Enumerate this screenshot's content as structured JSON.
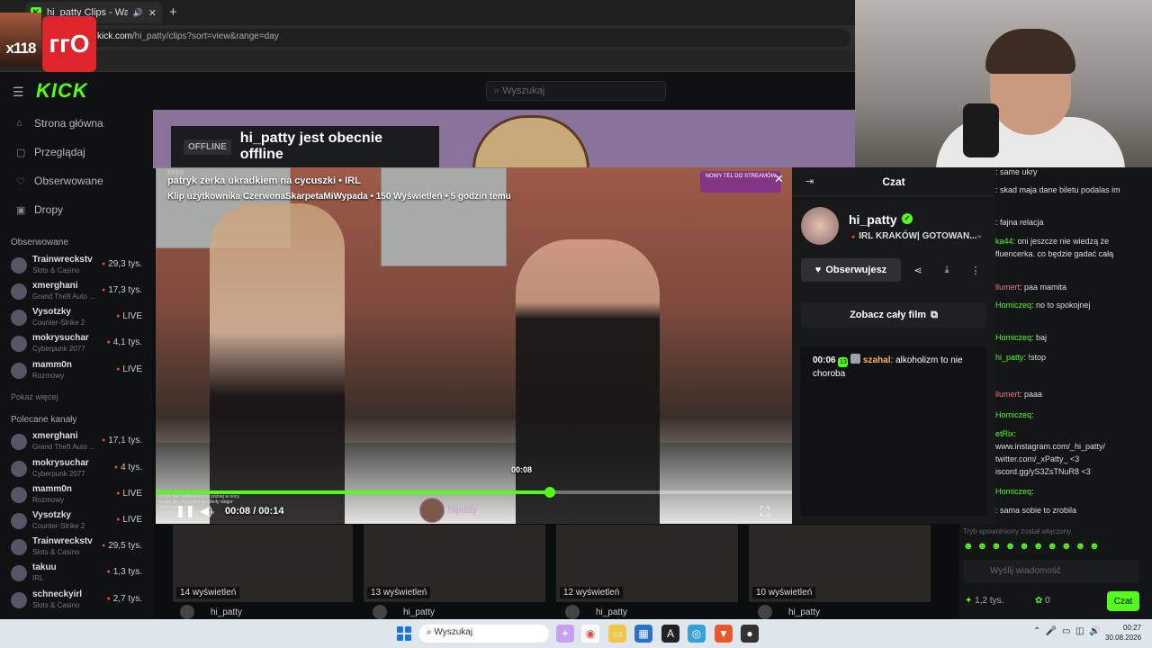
{
  "browser": {
    "tab_title": "hi_patty Clips - Watch Live",
    "url_host": "kick.com",
    "url_path": "/hi_patty/clips?sort=view&range=day"
  },
  "overlay": {
    "logo_left": "x118",
    "logo_right": "ᴦᴦO"
  },
  "kick": {
    "logo": "KICK",
    "search_placeholder": "Wyszukaj",
    "nav": [
      "Strona główna",
      "Przeglądaj",
      "Obserwowane",
      "Dropy"
    ],
    "followed_title": "Obserwowane",
    "followed": [
      {
        "name": "Trainwreckstv",
        "cat": "Slots & Casino",
        "viewers": "29,3 tys."
      },
      {
        "name": "xmerghani",
        "cat": "Grand Theft Auto ...",
        "viewers": "17,3 tys."
      },
      {
        "name": "Vysotzky",
        "cat": "Counter-Strike 2",
        "viewers": "LIVE"
      },
      {
        "name": "mokrysuchar",
        "cat": "Cyberpunk 2077",
        "viewers": "4,1 tys."
      },
      {
        "name": "mamm0n",
        "cat": "Rozmowy",
        "viewers": "LIVE"
      }
    ],
    "show_more": "Pokaż więcej",
    "recommended_title": "Polecane kanały",
    "recommended": [
      {
        "name": "xmerghani",
        "cat": "Grand Theft Auto ...",
        "viewers": "17,1 tys."
      },
      {
        "name": "mokrysuchar",
        "cat": "Cyberpunk 2077",
        "viewers": "4 tys."
      },
      {
        "name": "mamm0n",
        "cat": "Rozmowy",
        "viewers": "LIVE"
      },
      {
        "name": "Vysotzky",
        "cat": "Counter-Strike 2",
        "viewers": "LIVE"
      },
      {
        "name": "Trainwreckstv",
        "cat": "Slots & Casino",
        "viewers": "29,5 tys."
      },
      {
        "name": "takuu",
        "cat": "IRL",
        "viewers": "1,3 tys."
      },
      {
        "name": "schneckyirl",
        "cat": "Slots & Casino",
        "viewers": "2,7 tys."
      }
    ],
    "offline_tag": "OFFLINE",
    "offline_text": "hi_patty jest obecnie offline",
    "clips": [
      {
        "views": "14 wyświetleń",
        "author": "hi_patty"
      },
      {
        "views": "13 wyświetleń",
        "author": "hi_patty"
      },
      {
        "views": "12 wyświetleń",
        "author": "hi_patty"
      },
      {
        "views": "10 wyświetleń",
        "author": "hi_patty"
      }
    ]
  },
  "player": {
    "free_tag": "FREE",
    "title": "patryk zerka ukradkiem na cycuszki • IRL",
    "subtitle": "Klip użytkownika CzerwonaSkarpetaMiWypada • 150 Wyświetleń • 5 godzin temu",
    "promo": "NOWY TEL DO STREAMÓW",
    "hover_time": "00:08",
    "time": "00:08 / 00:14",
    "progress": 0.62,
    "watermark": "hipatty"
  },
  "chatpanel": {
    "title": "Czat",
    "channel": "hi_patty",
    "live_title": "IRL KRAKÓW| GOTOWAN...",
    "follow_label": "Obserwujesz",
    "full_label": "Zobacz cały film",
    "message": {
      "time": "00:06",
      "badge": "13",
      "user": "szahal",
      "text": "alkoholizm to nie choroba"
    }
  },
  "right_chat": {
    "messages": [
      {
        "user": "",
        "text": ": same ukry"
      },
      {
        "user": "",
        "text": ": skad maja dane biletu podalas im"
      },
      {
        "user": "",
        "text": ": fajna relacja"
      },
      {
        "user": "ka44",
        "text": ": oni jeszcze nie wiedzą że"
      },
      {
        "user": "",
        "text": "fluencerka. co będzie gadać całą"
      },
      {
        "user": "llumert",
        "text": ": paa mamita"
      },
      {
        "user": "Homiczeq",
        "text": ": no to spokojnej"
      },
      {
        "user": "Homiczeq",
        "text": ": baj"
      },
      {
        "user": "hi_patty",
        "text": ": !stop"
      },
      {
        "user": "llumert",
        "text": ": paaa"
      },
      {
        "user": "Homiczeq",
        "text": ":"
      },
      {
        "user": "etRix",
        "text": ":"
      },
      {
        "user": "",
        "text": "www.instagram.com/_hi_patty/"
      },
      {
        "user": "",
        "text": "twitter.com/_xPatty_ <3"
      },
      {
        "user": "",
        "text": "iscord.gg/yS3ZsTNuR8 <3"
      },
      {
        "user": "Homiczeq",
        "text": ":"
      },
      {
        "user": "",
        "text": ": sama sobie to zrobila"
      }
    ],
    "notice": "Tryb spowolniony został włączony",
    "input_placeholder": "Wyślij wiadomość",
    "points": "1,2 tys.",
    "zero": "0",
    "send": "Czat"
  },
  "taskbar": {
    "search": "Wyszukaj",
    "time": "00:27",
    "date": "30.08.2026"
  }
}
